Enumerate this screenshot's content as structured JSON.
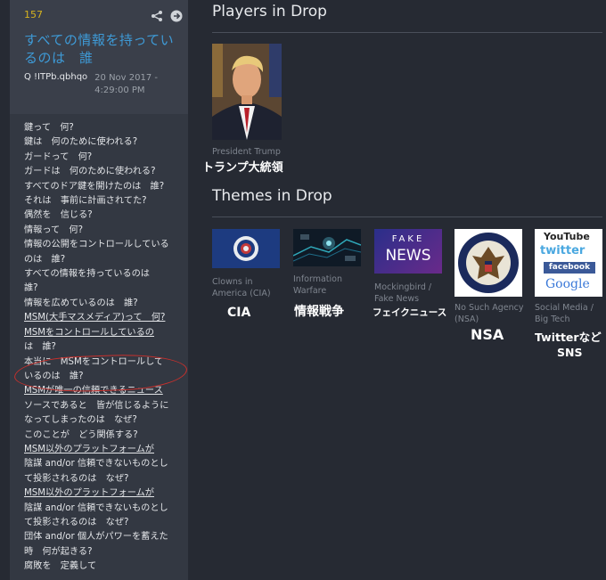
{
  "post": {
    "number": "157",
    "title": "すべての情報を持っているのは　誰",
    "author": "Q !ITPb.qbhqo",
    "date_line1": "20 Nov 2017 -",
    "date_line2": "4:29:00 PM",
    "lines": [
      "鍵って　何?",
      "鍵は　何のために使われる?",
      "ガードって　何?",
      "ガードは　何のために使われる?",
      "すべてのドア鍵を開けたのは　誰?",
      "それは　事前に計画されてた?",
      "偶然を　信じる?",
      "情報って　何?",
      "情報の公開をコントロールしている",
      "のは　誰?",
      "すべての情報を持っているのは",
      "誰?",
      "情報を広めているのは　誰?",
      "MSM(大手マスメディア)って　何?",
      "MSMをコントロールしているの",
      "は　誰?",
      "本当に　MSMをコントロールして",
      "いるのは　誰?",
      "MSMが唯一の信頼できるニュース",
      "ソースであると　皆が信じるように",
      "なってしまったのは　なぜ?",
      "このことが　どう関係する?",
      "MSM以外のプラットフォームが",
      "陰謀 and/or 信頼できないものとし",
      "て投影されるのは　なぜ?",
      "MSM以外のプラットフォームが",
      "陰謀 and/or 信頼できないものとし",
      "て投影されるのは　なぜ?",
      "団体 and/or 個人がパワーを蓄えた",
      "時　何が起きる?",
      "腐敗を　定義して"
    ]
  },
  "players": {
    "title": "Players in Drop",
    "caption": "President Trump",
    "jp_label": "トランプ大統領"
  },
  "themes": {
    "title": "Themes in Drop",
    "items": [
      {
        "caption": "Clowns in America (CIA)",
        "jp": "CIA"
      },
      {
        "caption": "Information Warfare",
        "jp": "情報戦争"
      },
      {
        "caption": "Mockingbird / Fake News",
        "jp": "フェイクニュース",
        "img_word1": "FAKE",
        "img_word2": "NEWS"
      },
      {
        "caption": "No Such Agency (NSA)",
        "jp": "NSA"
      },
      {
        "caption": "Social Media / Big Tech",
        "jp": "Twitterなど",
        "jp2": "SNS",
        "logo_youtube": "YouTube",
        "logo_twitter": "twitter",
        "logo_facebook": "facebook",
        "logo_google": "Google"
      }
    ]
  }
}
